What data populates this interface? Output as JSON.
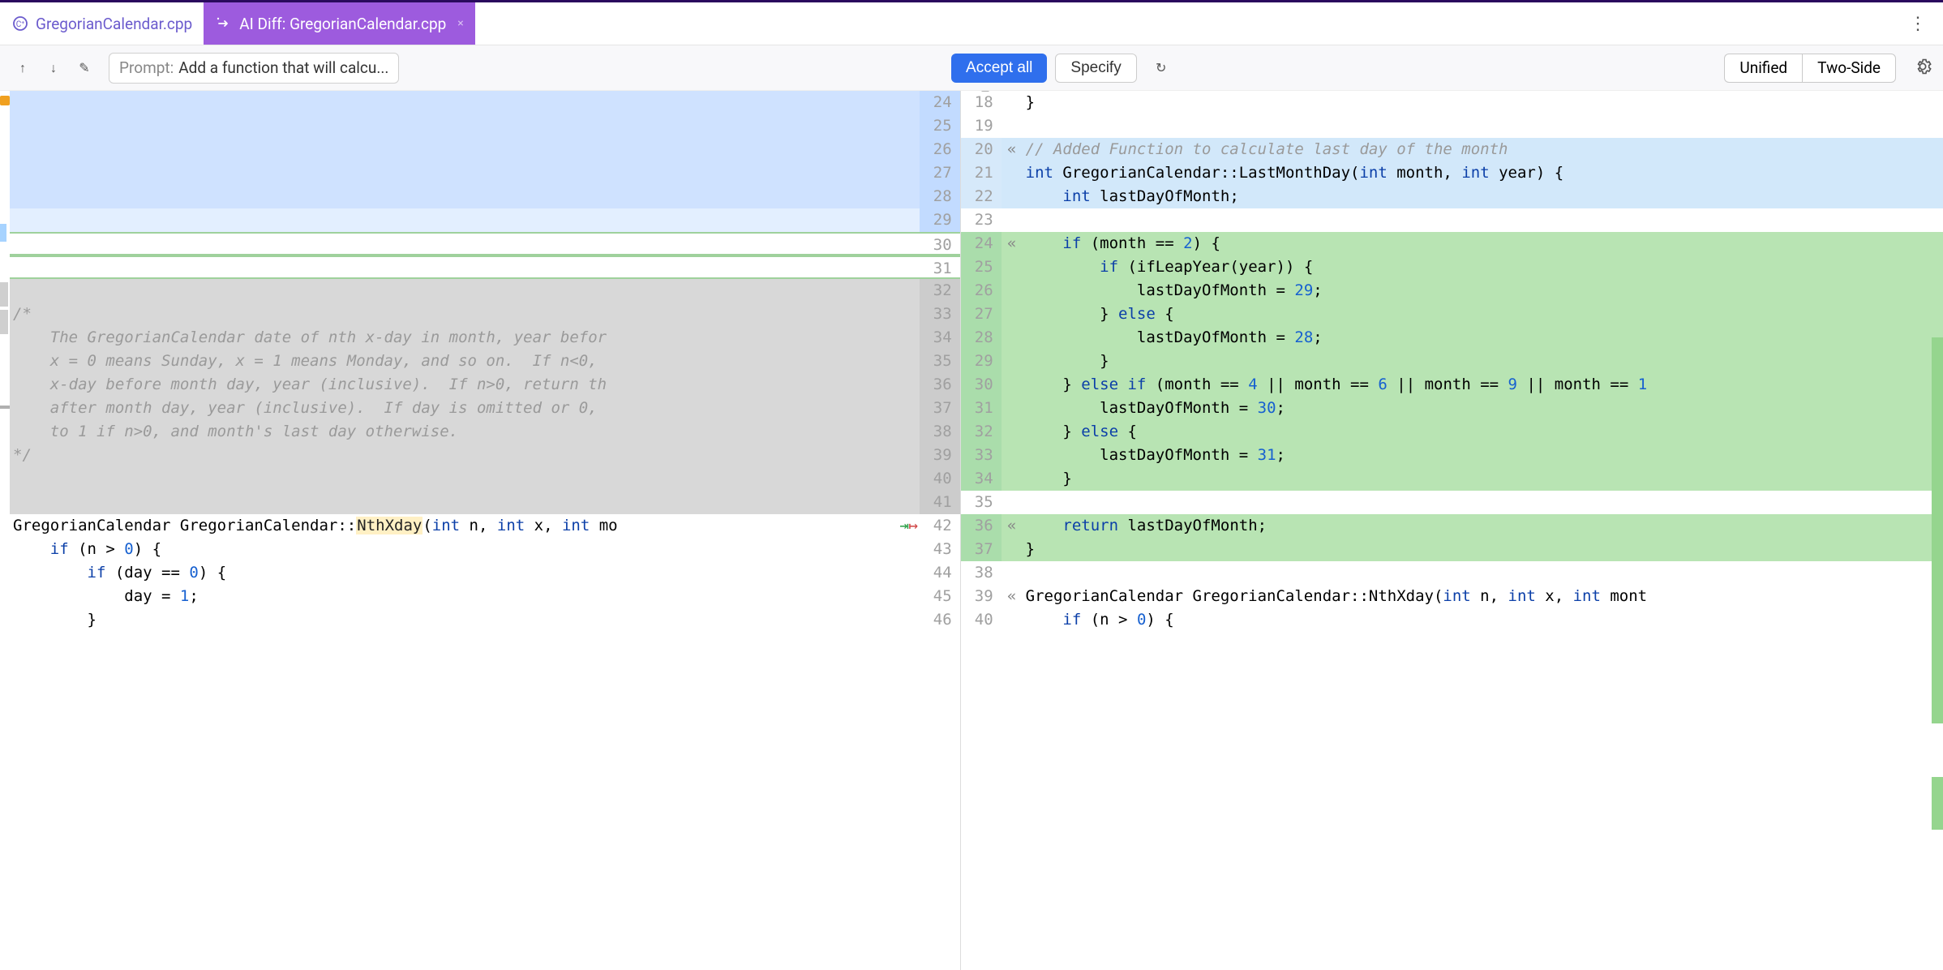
{
  "tabs": {
    "file": {
      "label": "GregorianCalendar.cpp"
    },
    "diff": {
      "label": "AI Diff: GregorianCalendar.cpp"
    }
  },
  "toolbar": {
    "prompt_label": "Prompt:",
    "prompt_value": "Add a function that will calcu...",
    "accept": "Accept all",
    "specify": "Specify",
    "unified": "Unified",
    "twoside": "Two-Side"
  },
  "icons": {
    "more": "⋮",
    "up": "↑",
    "down": "↓",
    "edit": "✎",
    "refresh": "↻",
    "gear": "⚙",
    "lock": "🔒",
    "check": "✓",
    "collapse": "«",
    "move_in": "⇥",
    "move_out": "↦"
  },
  "left": {
    "lines": [
      {
        "ln": "24",
        "bg": "context",
        "text": ""
      },
      {
        "ln": "25",
        "bg": "context",
        "text": ""
      },
      {
        "ln": "26",
        "bg": "context",
        "text": ""
      },
      {
        "ln": "27",
        "bg": "context",
        "text": ""
      },
      {
        "ln": "28",
        "bg": "context",
        "text": ""
      },
      {
        "ln": "29",
        "bg": "context2",
        "text": ""
      },
      {
        "ln": "30",
        "bg": "white",
        "text": "",
        "thinGreen": true
      },
      {
        "ln": "31",
        "bg": "white",
        "text": "",
        "thinGreen": true
      },
      {
        "ln": "32",
        "bg": "grey",
        "text": ""
      },
      {
        "ln": "33",
        "bg": "grey",
        "text": "/*",
        "cls": "comment2"
      },
      {
        "ln": "34",
        "bg": "grey",
        "text": "    The GregorianCalendar date of nth x-day in month, year befor",
        "cls": "comment2"
      },
      {
        "ln": "35",
        "bg": "grey",
        "text": "    x = 0 means Sunday, x = 1 means Monday, and so on.  If n<0,",
        "cls": "comment2"
      },
      {
        "ln": "36",
        "bg": "grey",
        "text": "    x-day before month day, year (inclusive).  If n>0, return th",
        "cls": "comment2"
      },
      {
        "ln": "37",
        "bg": "grey",
        "text": "    after month day, year (inclusive).  If day is omitted or 0,",
        "cls": "comment2"
      },
      {
        "ln": "38",
        "bg": "grey",
        "text": "    to 1 if n>0, and month's last day otherwise.",
        "cls": "comment2"
      },
      {
        "ln": "39",
        "bg": "grey",
        "text": "*/",
        "cls": "comment2"
      },
      {
        "ln": "40",
        "bg": "grey",
        "text": ""
      },
      {
        "ln": "41",
        "bg": "grey",
        "text": ""
      },
      {
        "ln": "42",
        "bg": "white",
        "text": "GregorianCalendar GregorianCalendar::|H|NthXday|/H|(|K|int|/K| n, |K|int|/K| x, |K|int|/K| mo",
        "marker": "move"
      },
      {
        "ln": "43",
        "bg": "white",
        "text": "    |K|if|/K| (n > |N|0|/N|) {"
      },
      {
        "ln": "44",
        "bg": "white",
        "text": "        |K|if|/K| (day == |N|0|/N|) {"
      },
      {
        "ln": "45",
        "bg": "white",
        "text": "            day = |N|1|/N|;"
      },
      {
        "ln": "46",
        "bg": "white",
        "text": "        }"
      }
    ]
  },
  "right": {
    "lines": [
      {
        "ln": "18",
        "bg": "white",
        "text": "}"
      },
      {
        "ln": "19",
        "bg": "white",
        "text": ""
      },
      {
        "ln": "20",
        "bg": "addh",
        "marker": "collapse",
        "text": "|C|// Added Function to calculate last day of the month|/C|"
      },
      {
        "ln": "21",
        "bg": "addh",
        "text": "|K|int|/K| GregorianCalendar::LastMonthDay(|K|int|/K| month, |K|int|/K| year) {"
      },
      {
        "ln": "22",
        "bg": "addh",
        "text": "    |K|int|/K| lastDayOfMonth;"
      },
      {
        "ln": "23",
        "bg": "white",
        "text": ""
      },
      {
        "ln": "24",
        "bg": "add",
        "marker": "collapse",
        "text": "    |K|if|/K| (month == |N|2|/N|) {"
      },
      {
        "ln": "25",
        "bg": "add",
        "text": "        |K|if|/K| (ifLeapYear(year)) {"
      },
      {
        "ln": "26",
        "bg": "add",
        "text": "            lastDayOfMonth = |N|29|/N|;"
      },
      {
        "ln": "27",
        "bg": "add",
        "text": "        } |K|else|/K| {"
      },
      {
        "ln": "28",
        "bg": "add",
        "text": "            lastDayOfMonth = |N|28|/N|;"
      },
      {
        "ln": "29",
        "bg": "add",
        "text": "        }"
      },
      {
        "ln": "30",
        "bg": "add",
        "text": "    } |K|else if|/K| (month == |N|4|/N| || month == |N|6|/N| || month == |N|9|/N| || month == |N|1|/N|"
      },
      {
        "ln": "31",
        "bg": "add",
        "text": "        lastDayOfMonth = |N|30|/N|;"
      },
      {
        "ln": "32",
        "bg": "add",
        "text": "    } |K|else|/K| {"
      },
      {
        "ln": "33",
        "bg": "add",
        "text": "        lastDayOfMonth = |N|31|/N|;"
      },
      {
        "ln": "34",
        "bg": "add",
        "text": "    }"
      },
      {
        "ln": "35",
        "bg": "white",
        "text": ""
      },
      {
        "ln": "36",
        "bg": "add",
        "marker": "collapse",
        "text": "    |K|return|/K| lastDayOfMonth;"
      },
      {
        "ln": "37",
        "bg": "add",
        "text": "}"
      },
      {
        "ln": "38",
        "bg": "white",
        "text": ""
      },
      {
        "ln": "39",
        "bg": "white",
        "marker": "collapse",
        "text": "GregorianCalendar GregorianCalendar::NthXday(|K|int|/K| n, |K|int|/K| x, |K|int|/K| mont"
      },
      {
        "ln": "40",
        "bg": "white",
        "text": "    |K|if|/K| (n > |N|0|/N|) {"
      }
    ]
  }
}
